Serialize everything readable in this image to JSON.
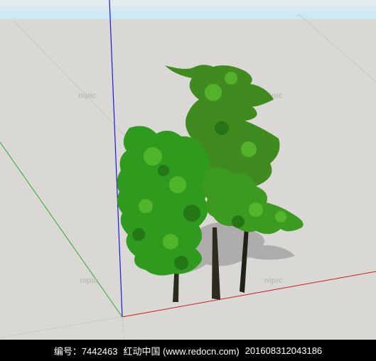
{
  "viewport": {
    "sky_color": "#c6e7f3",
    "ground_color": "#d9d8d4",
    "axes": {
      "blue_axis_color": "#1a1adc",
      "red_axis_color": "#c81e1e",
      "green_axis_color": "#2faa2f"
    },
    "watermark": "nipic",
    "model": "3 trees component"
  },
  "footer": {
    "id_label": "编号：7442463",
    "site": "红动中国 (www.redocn.com)",
    "serial": "20160831204318​6"
  }
}
